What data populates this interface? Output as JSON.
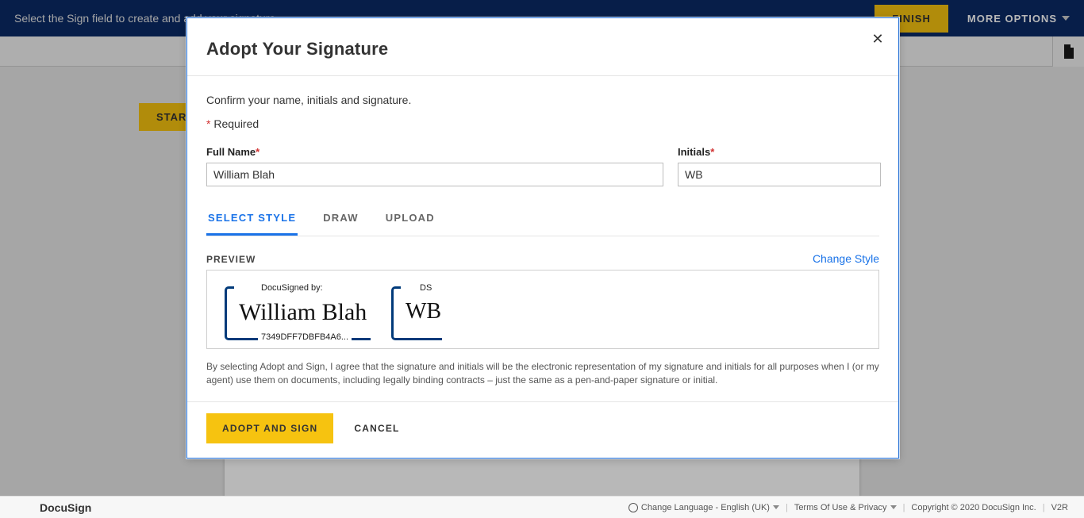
{
  "banner": {
    "instruction": "Select the Sign field to create and add your signature.",
    "finish_label": "FINISH",
    "more_options_label": "MORE OPTIONS"
  },
  "docarea": {
    "start_label": "START"
  },
  "modal": {
    "title": "Adopt Your Signature",
    "confirm_text": "Confirm your name, initials and signature.",
    "required_text": "Required",
    "full_name_label": "Full Name",
    "full_name_value": "William Blah",
    "initials_label": "Initials",
    "initials_value": "WB",
    "tabs": {
      "select_style": "SELECT STYLE",
      "draw": "DRAW",
      "upload": "UPLOAD"
    },
    "preview_label": "PREVIEW",
    "change_style": "Change Style",
    "preview": {
      "signed_by": "DocuSigned by:",
      "signature_text": "William Blah",
      "signature_code": "7349DFF7DBFB4A6...",
      "initials_header": "DS",
      "initials_text": "WB"
    },
    "legal_text": "By selecting Adopt and Sign, I agree that the signature and initials will be the electronic representation of my signature and initials for all purposes when I (or my agent) use them on documents, including legally binding contracts – just the same as a pen-and-paper signature or initial.",
    "adopt_label": "ADOPT AND SIGN",
    "cancel_label": "CANCEL"
  },
  "footer": {
    "brand": "DocuSign",
    "language_label": "Change Language - English (UK)",
    "terms_label": "Terms Of Use & Privacy",
    "copyright": "Copyright © 2020 DocuSign Inc.",
    "version": "V2R"
  }
}
